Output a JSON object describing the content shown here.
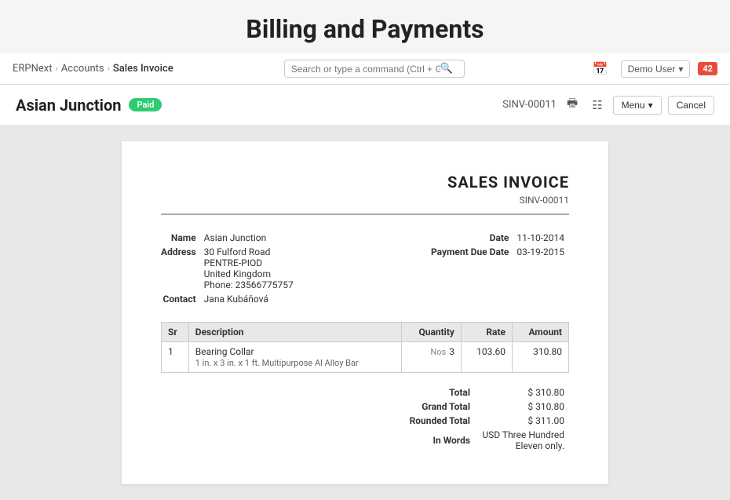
{
  "page": {
    "main_title": "Billing and Payments"
  },
  "navbar": {
    "breadcrumb": {
      "root": "ERPNext",
      "level1": "Accounts",
      "level2": "Sales Invoice"
    },
    "search_placeholder": "Search or type a command (Ctrl + G)",
    "user_label": "Demo User",
    "notification_count": "42"
  },
  "doc_header": {
    "title": "Asian Junction",
    "status": "Paid",
    "doc_id": "SINV-00011",
    "menu_label": "Menu",
    "cancel_label": "Cancel"
  },
  "invoice": {
    "title": "SALES INVOICE",
    "invoice_number": "SINV-00011",
    "party": {
      "name_label": "Name",
      "name_value": "Asian Junction",
      "address_label": "Address",
      "address_line1": "30 Fulford Road",
      "address_line2": "PENTRE-PIOD",
      "address_line3": "United Kingdom",
      "address_phone": "Phone: 23566775757",
      "contact_label": "Contact",
      "contact_value": "Jana Kubáňová",
      "date_label": "Date",
      "date_value": "11-10-2014",
      "payment_due_label": "Payment Due Date",
      "payment_due_value": "03-19-2015"
    },
    "table": {
      "headers": [
        "Sr",
        "Description",
        "Quantity",
        "Rate",
        "Amount"
      ],
      "rows": [
        {
          "sr": "1",
          "description": "Bearing Collar",
          "description_sub": "1 in. x 3 in. x 1 ft. Multipurpose Al Alloy Bar",
          "uom": "Nos",
          "quantity": "3",
          "rate": "103.60",
          "amount": "310.80"
        }
      ]
    },
    "totals": {
      "total_label": "Total",
      "total_value": "$ 310.80",
      "grand_total_label": "Grand Total",
      "grand_total_value": "$ 310.80",
      "rounded_total_label": "Rounded Total",
      "rounded_total_value": "$ 311.00",
      "in_words_label": "In Words",
      "in_words_value": "USD Three Hundred Eleven only."
    }
  }
}
